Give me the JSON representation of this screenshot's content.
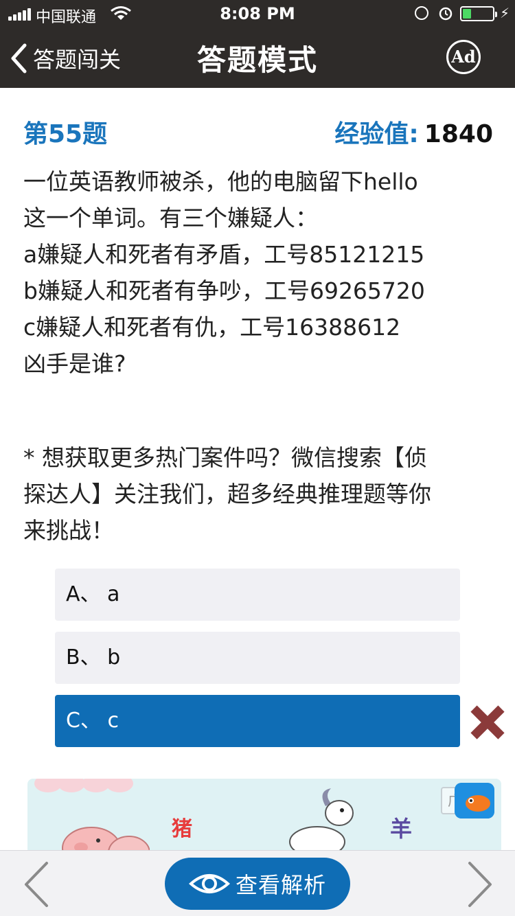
{
  "status_bar": {
    "carrier": "中国联通",
    "time": "8:08 PM"
  },
  "nav": {
    "back_label": "答题闯关",
    "title": "答题模式",
    "ad_label": "Ad"
  },
  "question": {
    "number_label": "第55题",
    "xp_label": "经验值",
    "xp_colon": ":",
    "xp_value": "1840",
    "lines": [
      "一位英语教师被杀，他的电脑留下hello",
      "这一个单词。有三个嫌疑人：",
      "a嫌疑人和死者有矛盾，工号85121215",
      "b嫌疑人和死者有争吵，工号69265720",
      "c嫌疑人和死者有仇，工号16388612",
      "凶手是谁?"
    ]
  },
  "promo": {
    "lines": [
      "*  想获取更多热门案件吗？微信搜索【侦",
      "探达人】关注我们，超多经典推理题等你",
      "来挑战！"
    ]
  },
  "options": [
    {
      "label": "A、 a",
      "state": "normal"
    },
    {
      "label": "B、 b",
      "state": "normal"
    },
    {
      "label": "C、 c",
      "state": "selected-wrong"
    }
  ],
  "ad_banner": {
    "char_pig": "猪",
    "char_goat": "羊",
    "tag": "广"
  },
  "bottom_bar": {
    "analysis_label": "查看解析"
  },
  "colors": {
    "header_bg": "#2e2b29",
    "accent_blue": "#1a75bc",
    "selected_option": "#0f6db5",
    "option_bg": "#f0f0f4",
    "wrong_mark": "#8b3a3a",
    "battery": "#4cd964"
  },
  "icons": [
    "signal-icon",
    "wifi-icon",
    "orientation-lock-icon",
    "alarm-icon",
    "battery-icon",
    "charging-icon",
    "chevron-left-icon",
    "ad-icon",
    "wrong-x-icon",
    "eye-icon",
    "arrow-left-icon",
    "arrow-right-icon"
  ]
}
